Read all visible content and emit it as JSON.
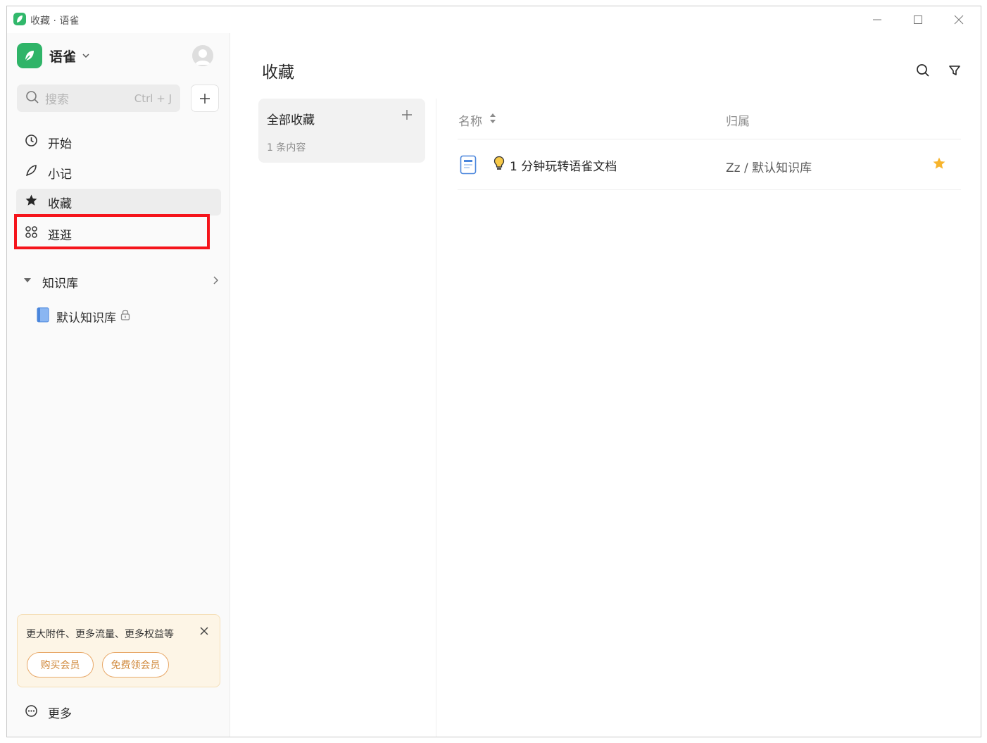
{
  "window": {
    "title": "收藏 · 语雀"
  },
  "sidebar": {
    "brand": "语雀",
    "search": {
      "placeholder": "搜索",
      "shortcut": "Ctrl + J"
    },
    "nav": [
      {
        "label": "开始",
        "icon": "clock-icon"
      },
      {
        "label": "小记",
        "icon": "feather-icon"
      },
      {
        "label": "收藏",
        "icon": "star-icon",
        "active": true
      },
      {
        "label": "逛逛",
        "icon": "grid-icon",
        "highlighted": true
      }
    ],
    "knowledge": {
      "header": "知识库",
      "items": [
        {
          "label": "默认知识库",
          "locked": true
        }
      ]
    },
    "promo": {
      "text": "更大附件、更多流量、更多权益等",
      "buy_label": "购买会员",
      "free_label": "免费领会员"
    },
    "more_label": "更多"
  },
  "main": {
    "title": "收藏",
    "group": {
      "name": "全部收藏",
      "count": "1 条内容"
    },
    "table": {
      "headers": {
        "name": "名称",
        "belongs": "归属"
      },
      "rows": [
        {
          "title": "1 分钟玩转语雀文档",
          "belongs": "Zz / 默认知识库",
          "starred": true
        }
      ]
    }
  },
  "colors": {
    "brand_green": "#2fb468",
    "highlight_red": "#f5141b",
    "star_yellow": "#f7b42c",
    "promo_bg": "#fdf5e6"
  }
}
